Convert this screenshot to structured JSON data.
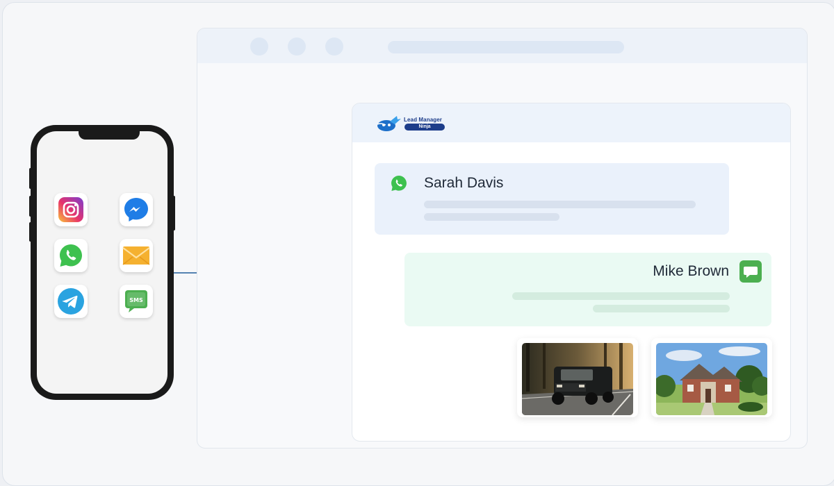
{
  "phone": {
    "apps": [
      {
        "icon": "instagram-icon"
      },
      {
        "icon": "messenger-icon"
      },
      {
        "icon": "whatsapp-icon"
      },
      {
        "icon": "email-icon"
      },
      {
        "icon": "telegram-icon"
      },
      {
        "icon": "sms-icon",
        "label": "SMS"
      }
    ]
  },
  "logo": {
    "line1": "Lead Manager",
    "line2": "Ninja"
  },
  "conversations": [
    {
      "name": "Sarah Davis",
      "channel_icon": "whatsapp-icon"
    },
    {
      "name": "Mike Brown",
      "channel_icon": "chat-bubble-icon"
    }
  ],
  "attachments": [
    {
      "subject": "black SUV on road"
    },
    {
      "subject": "brick house with lawn"
    }
  ],
  "colors": {
    "brand": "#1d3d8a",
    "whatsapp": "#3ec14f",
    "sms": "#4caf50",
    "arrow": "#1f5c99"
  }
}
